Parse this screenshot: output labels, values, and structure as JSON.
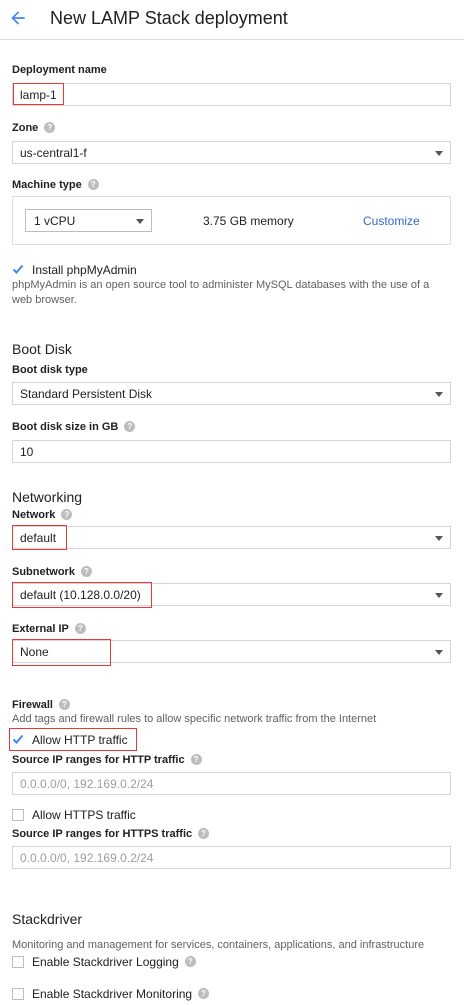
{
  "header": {
    "title": "New LAMP Stack deployment"
  },
  "deployment_name": {
    "label": "Deployment name",
    "value": "lamp-1"
  },
  "zone": {
    "label": "Zone",
    "value": "us-central1-f"
  },
  "machine_type": {
    "label": "Machine type",
    "cpu_value": "1 vCPU",
    "memory": "3.75 GB memory",
    "customize_label": "Customize"
  },
  "phpmyadmin": {
    "label": "Install phpMyAdmin",
    "checked": true,
    "description": "phpMyAdmin is an open source tool to administer MySQL databases with the use of a web browser."
  },
  "boot_disk": {
    "heading": "Boot Disk",
    "type_label": "Boot disk type",
    "type_value": "Standard Persistent Disk",
    "size_label": "Boot disk size in GB",
    "size_value": "10"
  },
  "networking": {
    "heading": "Networking",
    "network_label": "Network",
    "network_value": "default",
    "subnetwork_label": "Subnetwork",
    "subnetwork_value": "default (10.128.0.0/20)",
    "external_ip_label": "External IP",
    "external_ip_value": "None"
  },
  "firewall": {
    "label": "Firewall",
    "description": "Add tags and firewall rules to allow specific network traffic from the Internet",
    "http_label": "Allow HTTP traffic",
    "http_checked": true,
    "http_ranges_label": "Source IP ranges for HTTP traffic",
    "http_ranges_placeholder": "0.0.0.0/0, 192.169.0.2/24",
    "https_label": "Allow HTTPS traffic",
    "https_checked": false,
    "https_ranges_label": "Source IP ranges for HTTPS traffic",
    "https_ranges_placeholder": "0.0.0.0/0, 192.169.0.2/24"
  },
  "stackdriver": {
    "heading": "Stackdriver",
    "description": "Monitoring and management for services, containers, applications, and infrastructure",
    "logging_label": "Enable Stackdriver Logging",
    "monitoring_label": "Enable Stackdriver Monitoring"
  },
  "help_glyph": "?",
  "colors": {
    "accent": "#3367d6",
    "highlight": "#e53935",
    "check": "#4285f4"
  }
}
